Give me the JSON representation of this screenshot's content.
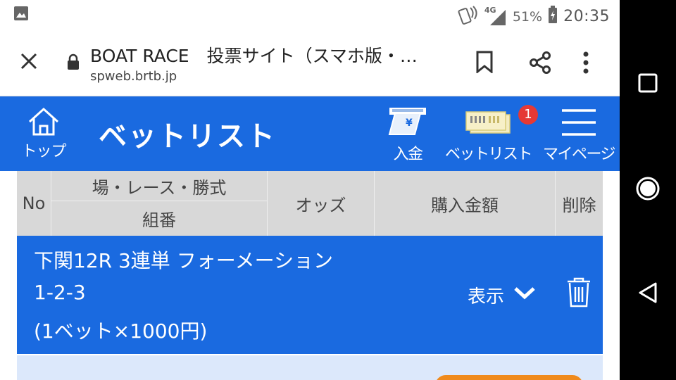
{
  "status_bar": {
    "battery_percent": "51%",
    "network": "4G",
    "time": "20:35"
  },
  "browser": {
    "title": "BOAT RACE　投票サイト（スマホ版・…",
    "url": "spweb.brtb.jp"
  },
  "header": {
    "home_label": "トップ",
    "page_title": "ベットリスト",
    "deposit_label": "入金",
    "betlist_label": "ベットリスト",
    "betlist_badge": "1",
    "mypage_label": "マイページ"
  },
  "table": {
    "headers": {
      "no": "No",
      "venue_race_type": "場・レース・勝式",
      "combination": "組番",
      "odds": "オッズ",
      "amount": "購入金額",
      "delete": "削除"
    },
    "rows": [
      {
        "race": "下関12R 3連単 フォーメーション",
        "combination": "1-2-3",
        "detail": "(1ベット×1000円)",
        "show_label": "表示"
      }
    ]
  },
  "colors": {
    "primary_blue": "#1a6ae0",
    "badge_red": "#e53935",
    "accent_orange": "#f08a1c"
  }
}
